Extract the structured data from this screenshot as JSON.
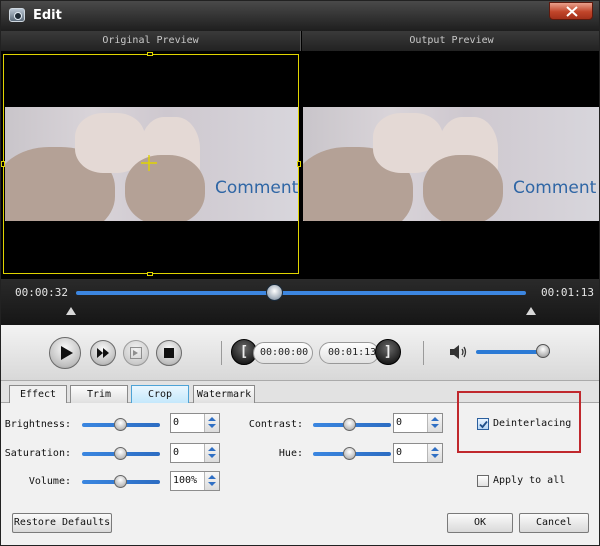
{
  "window": {
    "title": "Edit"
  },
  "preview": {
    "original_label": "Original Preview",
    "output_label": "Output Preview",
    "overlay_text": "Comment"
  },
  "timeline": {
    "current_time": "00:00:32",
    "total_time": "00:01:13",
    "progress": 0.44
  },
  "controls": {
    "start_time": "00:00:00",
    "end_time": "00:01:13",
    "start_bracket": "[",
    "end_bracket": "]",
    "volume": 0.9
  },
  "tabs": [
    {
      "label": "Effect",
      "state": "active"
    },
    {
      "label": "Trim",
      "state": "normal"
    },
    {
      "label": "Crop",
      "state": "hover"
    },
    {
      "label": "Watermark",
      "state": "normal"
    }
  ],
  "effect": {
    "brightness": {
      "label": "Brightness:",
      "value": "0",
      "level": 0.5
    },
    "saturation": {
      "label": "Saturation:",
      "value": "0",
      "level": 0.5
    },
    "volume": {
      "label": "Volume:",
      "value": "100%",
      "level": 0.5
    },
    "contrast": {
      "label": "Contrast:",
      "value": "0",
      "level": 0.5
    },
    "hue": {
      "label": "Hue:",
      "value": "0",
      "level": 0.5
    },
    "deinterlacing": {
      "label": "Deinterlacing",
      "checked": true
    },
    "apply_to_all": {
      "label": "Apply to all",
      "checked": false
    }
  },
  "buttons": {
    "restore_defaults": "Restore Defaults",
    "ok": "OK",
    "cancel": "Cancel"
  },
  "colors": {
    "accent": "#3c86e0",
    "highlight": "#c0282d",
    "crop_frame": "#e0d400"
  }
}
